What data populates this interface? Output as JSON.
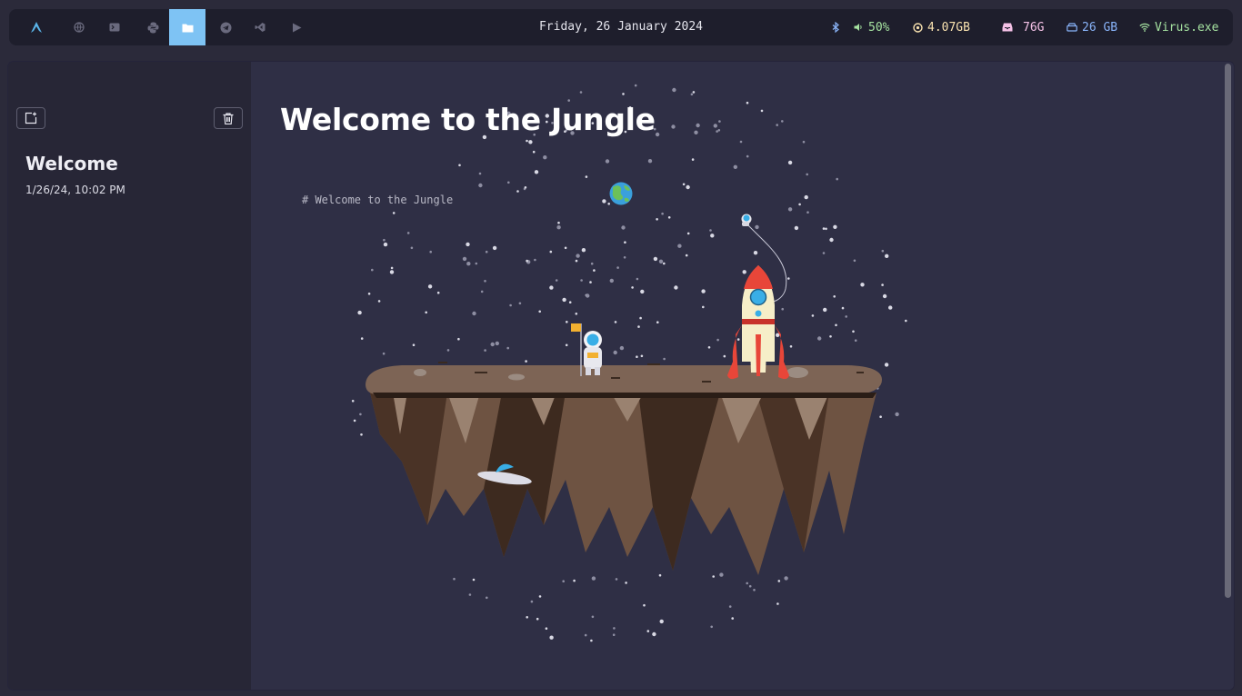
{
  "topbar": {
    "workspaces": [
      {
        "name": "arch-logo-icon",
        "active": false
      },
      {
        "name": "globe-icon",
        "active": false
      },
      {
        "name": "terminal-icon",
        "active": false
      },
      {
        "name": "python-icon",
        "active": false
      },
      {
        "name": "folder-icon",
        "active": true
      },
      {
        "name": "telegram-icon",
        "active": false
      },
      {
        "name": "vscode-icon",
        "active": false
      },
      {
        "name": "play-icon",
        "active": false
      }
    ],
    "clock": "Friday, 26 January 2024",
    "stats": {
      "bluetooth_icon": "bluetooth-icon",
      "volume": "50%",
      "memory": "4.07GB",
      "storage": "76G",
      "disk": "26 GB",
      "network": "Virus.exe"
    },
    "colors": {
      "bar_bg": "#1e1e2c",
      "active_ws": "#7ec3f4",
      "bluetooth": "#8ab4f8",
      "volume": "#a6e3a1",
      "memory": "#f9e2af",
      "storage": "#f5c2e7",
      "disk": "#89b4fa",
      "network": "#a6e3a1"
    }
  },
  "sidebar": {
    "new_note_icon": "new-note-icon",
    "delete_icon": "trash-icon",
    "notes": [
      {
        "title": "Welcome",
        "date": "1/26/24, 10:02 PM"
      }
    ]
  },
  "editor": {
    "title": "Welcome to the Jungle",
    "markdown_line": "# Welcome to the Jungle",
    "illustration": "floating-island-space-illustration"
  }
}
